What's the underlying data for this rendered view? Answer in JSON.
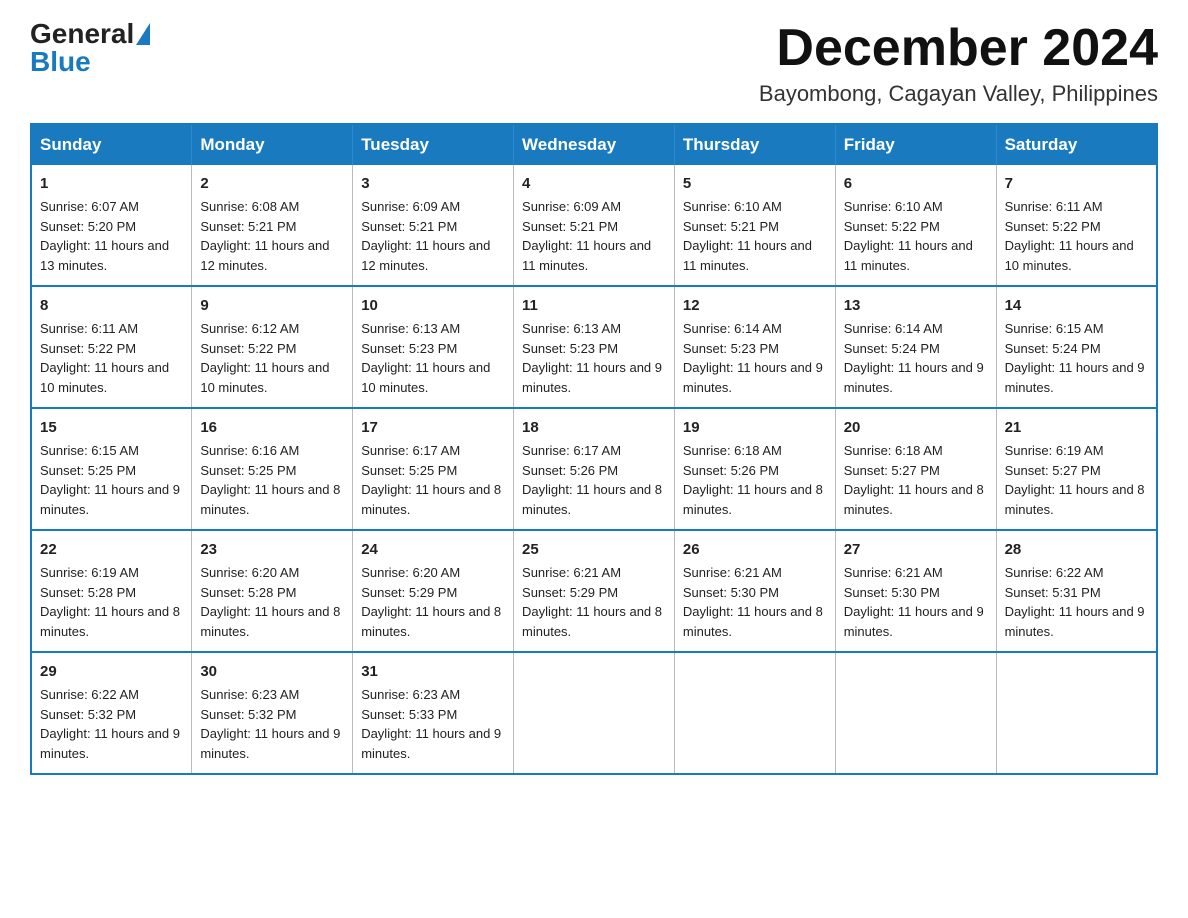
{
  "header": {
    "logo_general": "General",
    "logo_blue": "Blue",
    "month_title": "December 2024",
    "location": "Bayombong, Cagayan Valley, Philippines"
  },
  "days_of_week": [
    "Sunday",
    "Monday",
    "Tuesday",
    "Wednesday",
    "Thursday",
    "Friday",
    "Saturday"
  ],
  "weeks": [
    [
      {
        "day": "1",
        "sunrise": "6:07 AM",
        "sunset": "5:20 PM",
        "daylight": "11 hours and 13 minutes."
      },
      {
        "day": "2",
        "sunrise": "6:08 AM",
        "sunset": "5:21 PM",
        "daylight": "11 hours and 12 minutes."
      },
      {
        "day": "3",
        "sunrise": "6:09 AM",
        "sunset": "5:21 PM",
        "daylight": "11 hours and 12 minutes."
      },
      {
        "day": "4",
        "sunrise": "6:09 AM",
        "sunset": "5:21 PM",
        "daylight": "11 hours and 11 minutes."
      },
      {
        "day": "5",
        "sunrise": "6:10 AM",
        "sunset": "5:21 PM",
        "daylight": "11 hours and 11 minutes."
      },
      {
        "day": "6",
        "sunrise": "6:10 AM",
        "sunset": "5:22 PM",
        "daylight": "11 hours and 11 minutes."
      },
      {
        "day": "7",
        "sunrise": "6:11 AM",
        "sunset": "5:22 PM",
        "daylight": "11 hours and 10 minutes."
      }
    ],
    [
      {
        "day": "8",
        "sunrise": "6:11 AM",
        "sunset": "5:22 PM",
        "daylight": "11 hours and 10 minutes."
      },
      {
        "day": "9",
        "sunrise": "6:12 AM",
        "sunset": "5:22 PM",
        "daylight": "11 hours and 10 minutes."
      },
      {
        "day": "10",
        "sunrise": "6:13 AM",
        "sunset": "5:23 PM",
        "daylight": "11 hours and 10 minutes."
      },
      {
        "day": "11",
        "sunrise": "6:13 AM",
        "sunset": "5:23 PM",
        "daylight": "11 hours and 9 minutes."
      },
      {
        "day": "12",
        "sunrise": "6:14 AM",
        "sunset": "5:23 PM",
        "daylight": "11 hours and 9 minutes."
      },
      {
        "day": "13",
        "sunrise": "6:14 AM",
        "sunset": "5:24 PM",
        "daylight": "11 hours and 9 minutes."
      },
      {
        "day": "14",
        "sunrise": "6:15 AM",
        "sunset": "5:24 PM",
        "daylight": "11 hours and 9 minutes."
      }
    ],
    [
      {
        "day": "15",
        "sunrise": "6:15 AM",
        "sunset": "5:25 PM",
        "daylight": "11 hours and 9 minutes."
      },
      {
        "day": "16",
        "sunrise": "6:16 AM",
        "sunset": "5:25 PM",
        "daylight": "11 hours and 8 minutes."
      },
      {
        "day": "17",
        "sunrise": "6:17 AM",
        "sunset": "5:25 PM",
        "daylight": "11 hours and 8 minutes."
      },
      {
        "day": "18",
        "sunrise": "6:17 AM",
        "sunset": "5:26 PM",
        "daylight": "11 hours and 8 minutes."
      },
      {
        "day": "19",
        "sunrise": "6:18 AM",
        "sunset": "5:26 PM",
        "daylight": "11 hours and 8 minutes."
      },
      {
        "day": "20",
        "sunrise": "6:18 AM",
        "sunset": "5:27 PM",
        "daylight": "11 hours and 8 minutes."
      },
      {
        "day": "21",
        "sunrise": "6:19 AM",
        "sunset": "5:27 PM",
        "daylight": "11 hours and 8 minutes."
      }
    ],
    [
      {
        "day": "22",
        "sunrise": "6:19 AM",
        "sunset": "5:28 PM",
        "daylight": "11 hours and 8 minutes."
      },
      {
        "day": "23",
        "sunrise": "6:20 AM",
        "sunset": "5:28 PM",
        "daylight": "11 hours and 8 minutes."
      },
      {
        "day": "24",
        "sunrise": "6:20 AM",
        "sunset": "5:29 PM",
        "daylight": "11 hours and 8 minutes."
      },
      {
        "day": "25",
        "sunrise": "6:21 AM",
        "sunset": "5:29 PM",
        "daylight": "11 hours and 8 minutes."
      },
      {
        "day": "26",
        "sunrise": "6:21 AM",
        "sunset": "5:30 PM",
        "daylight": "11 hours and 8 minutes."
      },
      {
        "day": "27",
        "sunrise": "6:21 AM",
        "sunset": "5:30 PM",
        "daylight": "11 hours and 9 minutes."
      },
      {
        "day": "28",
        "sunrise": "6:22 AM",
        "sunset": "5:31 PM",
        "daylight": "11 hours and 9 minutes."
      }
    ],
    [
      {
        "day": "29",
        "sunrise": "6:22 AM",
        "sunset": "5:32 PM",
        "daylight": "11 hours and 9 minutes."
      },
      {
        "day": "30",
        "sunrise": "6:23 AM",
        "sunset": "5:32 PM",
        "daylight": "11 hours and 9 minutes."
      },
      {
        "day": "31",
        "sunrise": "6:23 AM",
        "sunset": "5:33 PM",
        "daylight": "11 hours and 9 minutes."
      },
      null,
      null,
      null,
      null
    ]
  ]
}
